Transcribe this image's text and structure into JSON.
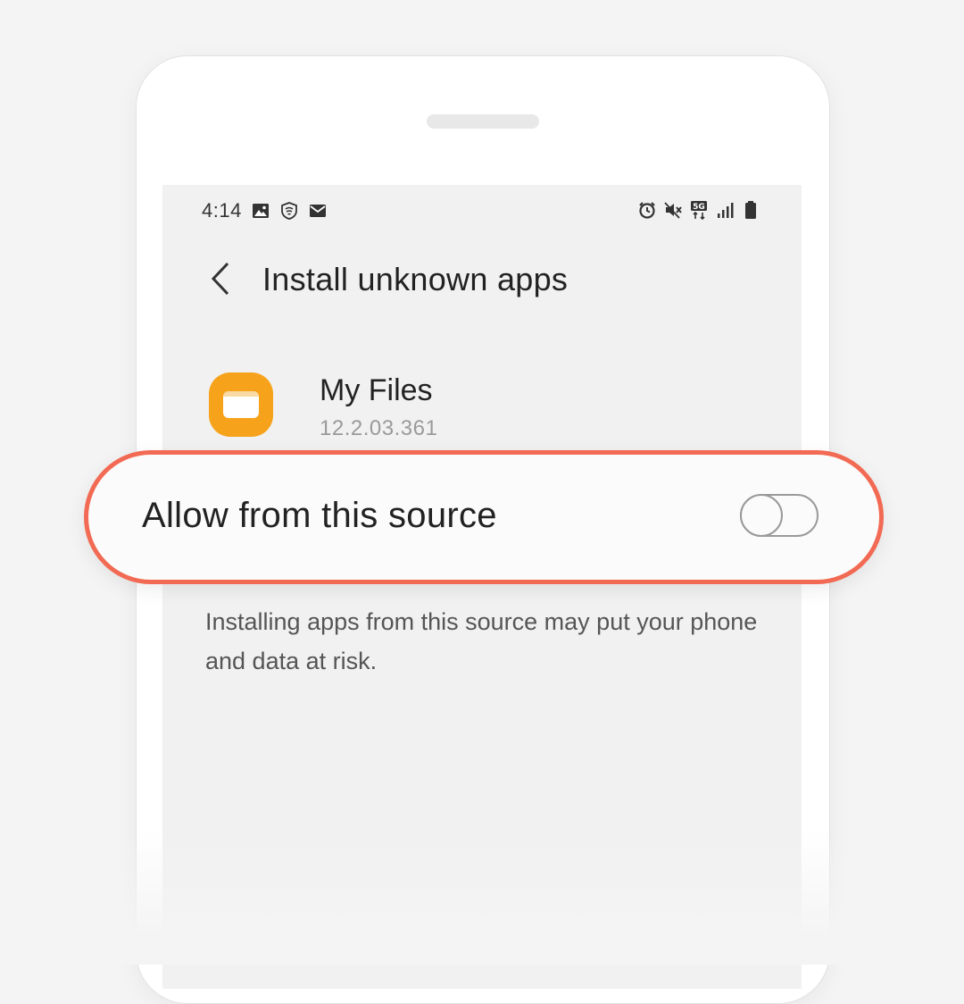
{
  "status_bar": {
    "time": "4:14",
    "left_icons": [
      "image-icon",
      "shield-icon",
      "mail-icon"
    ],
    "right_icons": [
      "alarm-icon",
      "mute-icon",
      "5g-icon",
      "signal-icon",
      "battery-icon"
    ],
    "network_label": "5G"
  },
  "header": {
    "back_icon": "chevron-left-icon",
    "title": "Install unknown apps"
  },
  "app": {
    "icon": "folder-icon",
    "name": "My Files",
    "version": "12.2.03.361",
    "icon_color": "#f6a21a"
  },
  "setting": {
    "label": "Allow from this source",
    "enabled": false,
    "highlight_color": "#f26a53"
  },
  "warning_text": "Installing apps from this source may put your phone and data at risk."
}
